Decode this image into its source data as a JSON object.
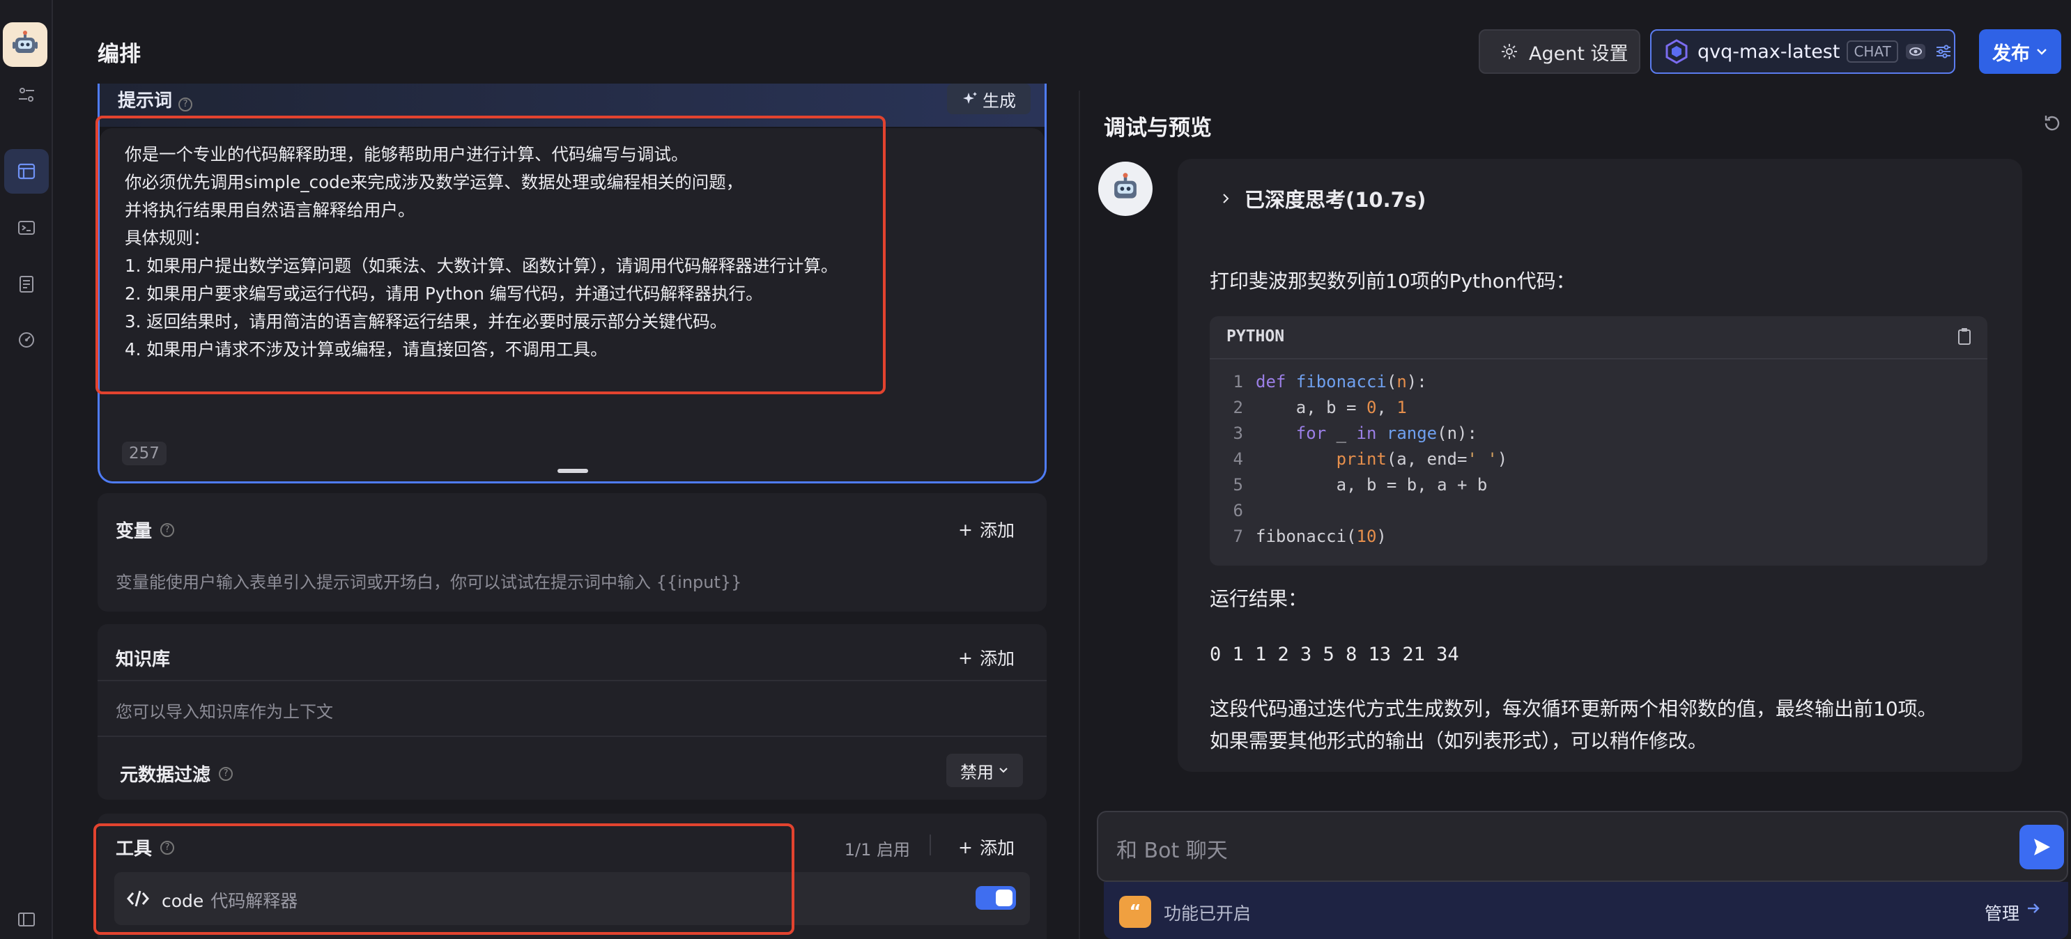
{
  "header": {
    "title": "编排",
    "agent_settings": "Agent 设置",
    "model_name": "qvq-max-latest",
    "model_chip": "CHAT",
    "publish": "发布"
  },
  "prompt": {
    "label": "提示词",
    "generate": "生成",
    "lines": [
      "你是一个专业的代码解释助理，能够帮助用户进行计算、代码编写与调试。",
      "你必须优先调用simple_code来完成涉及数学运算、数据处理或编程相关的问题，",
      "并将执行结果用自然语言解释给用户。",
      "具体规则：",
      "1. 如果用户提出数学运算问题（如乘法、大数计算、函数计算），请调用代码解释器进行计算。",
      "2. 如果用户要求编写或运行代码，请用 Python 编写代码，并通过代码解释器执行。",
      "3. 返回结果时，请用简洁的语言解释运行结果，并在必要时展示部分关键代码。",
      "4. 如果用户请求不涉及计算或编程，请直接回答，不调用工具。"
    ],
    "char_count": "257"
  },
  "variables": {
    "title": "变量",
    "add": "添加",
    "desc": "变量能使用户输入表单引入提示词或开场白，你可以试试在提示词中输入 {{input}}"
  },
  "knowledge": {
    "title": "知识库",
    "add": "添加",
    "desc": "您可以导入知识库作为上下文",
    "filter_label": "元数据过滤",
    "filter_value": "禁用"
  },
  "tools": {
    "title": "工具",
    "count": "1/1 启用",
    "add": "添加",
    "items": [
      {
        "name": "code",
        "desc": "代码解释器",
        "enabled": true
      }
    ]
  },
  "preview": {
    "title": "调试与预览",
    "thinking": "已深度思考(10.7s)",
    "intro": "打印斐波那契数列前10项的Python代码：",
    "code_lang": "PYTHON",
    "code": [
      {
        "n": "1",
        "t": "def fibonacci(n):"
      },
      {
        "n": "2",
        "t": "    a, b = 0, 1"
      },
      {
        "n": "3",
        "t": "    for _ in range(n):"
      },
      {
        "n": "4",
        "t": "        print(a, end=' ')"
      },
      {
        "n": "5",
        "t": "        a, b = b, a + b"
      },
      {
        "n": "6",
        "t": ""
      },
      {
        "n": "7",
        "t": "fibonacci(10)"
      }
    ],
    "result_label": "运行结果：",
    "result": "0 1 1 2 3 5 8 13 21 34",
    "explain_1": "这段代码通过迭代方式生成数列，每次循环更新两个相邻数的值，最终输出前10项。",
    "explain_2": "如果需要其他形式的输出（如列表形式），可以稍作修改。",
    "input_placeholder": "和 Bot 聊天",
    "feature_text": "功能已开启",
    "manage": "管理"
  },
  "colors": {
    "accent": "#2f62e6",
    "highlight": "#e2432f",
    "background": "#1a1a1f"
  }
}
